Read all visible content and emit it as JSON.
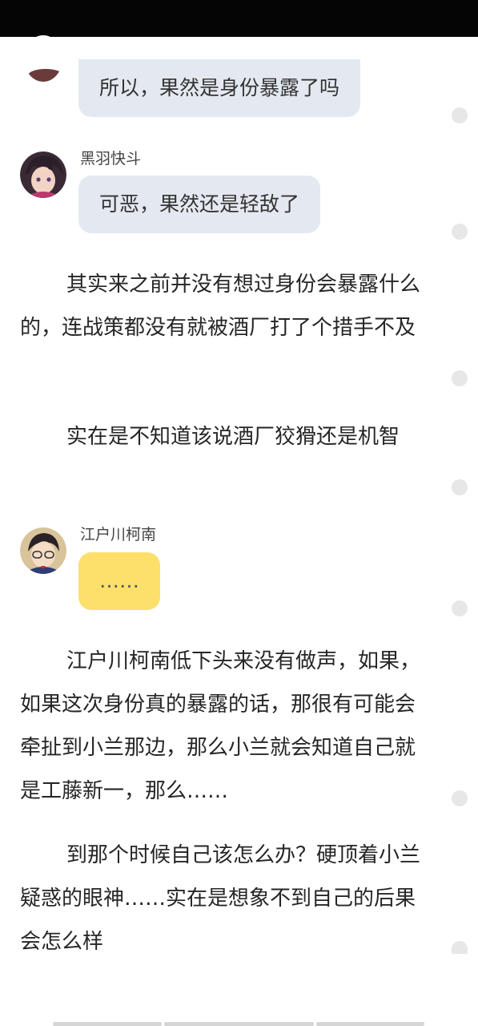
{
  "chat": [
    {
      "speaker": "",
      "text": "所以，果然是身份暴露了吗",
      "style": "grey",
      "avatar_icon": "anime-avatar-dark-icon"
    },
    {
      "speaker": "黑羽快斗",
      "text": "可恶，果然还是轻敌了",
      "style": "grey",
      "avatar_icon": "kaito-avatar-icon"
    },
    {
      "speaker": "江户川柯南",
      "text": "……",
      "style": "yellow",
      "avatar_icon": "conan-avatar-icon"
    }
  ],
  "paragraphs": [
    "其实来之前并没有想过身份会暴露什么的，连战策都没有就被酒厂打了个措手不及",
    "实在是不知道该说酒厂狡猾还是机智",
    "江户川柯南低下头来没有做声，如果，如果这次身份真的暴露的话，那很有可能会牵扯到小兰那边，那么小兰就会知道自己就是工藤新一，那么……",
    "到那个时候自己该怎么办？硬顶着小兰疑惑的眼神……实在是想象不到自己的后果会怎么样"
  ],
  "colors": {
    "status_bar": "#050505",
    "bubble_grey": "#e4e9f1",
    "bubble_yellow": "#fde06b",
    "side_dot": "#e7e7e7"
  }
}
